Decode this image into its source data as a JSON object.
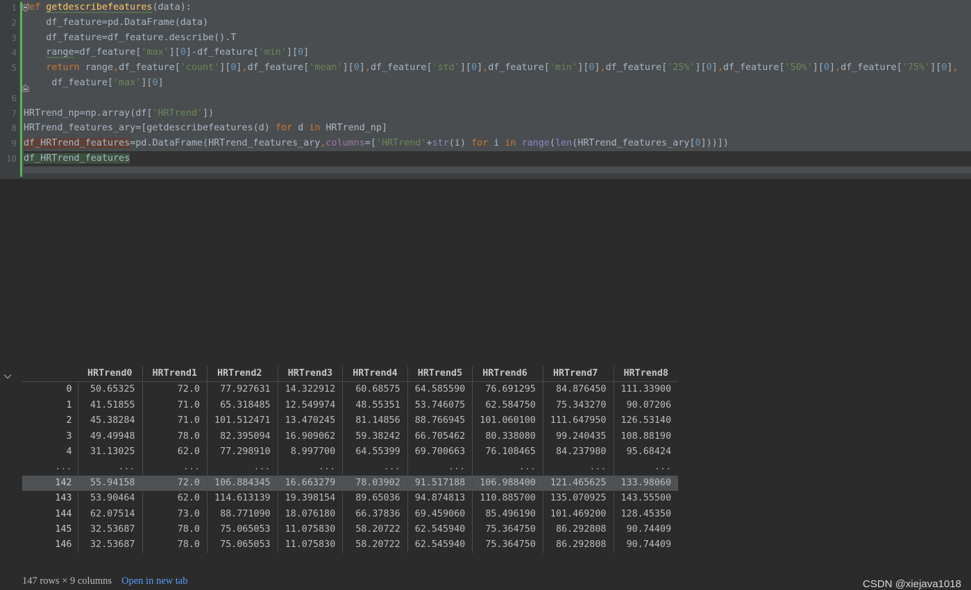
{
  "editor": {
    "line_numbers": [
      "1",
      "2",
      "3",
      "4",
      "5",
      "6",
      "7",
      "8",
      "9",
      "10"
    ],
    "lines": [
      "def getdescribefeatures(data):",
      "    df_feature=pd.DataFrame(data)",
      "    df_feature=df_feature.describe().T",
      "    range=df_feature['max'][0]-df_feature['min'][0]",
      "    return range,df_feature['count'][0],df_feature['mean'][0],df_feature['std'][0],df_feature['min'][0],df_feature['25%'][0],df_feature['50%'][0],df_feature['75%'][0],",
      "     df_feature['max'][0]",
      "",
      "HRTrend_np=np.array(df['HRTrend'])",
      "HRTrend_features_ary=[getdescribefeatures(d) for d in HRTrend_np]",
      "df_HRTrend_features=pd.DataFrame(HRTrend_features_ary,columns=['HRTrend'+str(i) for i in range(len(HRTrend_features_ary[0]))])",
      "df_HRTrend_features"
    ],
    "fold_icons": [
      "fold-collapse-icon",
      "fold-end-icon"
    ],
    "change_marker_color": "#55b555"
  },
  "output": {
    "expand_icon": "chevron-down-icon",
    "columns": [
      "HRTrend0",
      "HRTrend1",
      "HRTrend2",
      "HRTrend3",
      "HRTrend4",
      "HRTrend5",
      "HRTrend6",
      "HRTrend7",
      "HRTrend8"
    ],
    "rows": [
      {
        "index": "0",
        "selected": false,
        "values": [
          "50.65325",
          "72.0",
          "77.927631",
          "14.322912",
          "60.68575",
          "64.585590",
          "76.691295",
          "84.876450",
          "111.33900"
        ]
      },
      {
        "index": "1",
        "selected": false,
        "values": [
          "41.51855",
          "71.0",
          "65.318485",
          "12.549974",
          "48.55351",
          "53.746075",
          "62.584750",
          "75.343270",
          "90.07206"
        ]
      },
      {
        "index": "2",
        "selected": false,
        "values": [
          "45.38284",
          "71.0",
          "101.512471",
          "13.470245",
          "81.14856",
          "88.766945",
          "101.060100",
          "111.647950",
          "126.53140"
        ]
      },
      {
        "index": "3",
        "selected": false,
        "values": [
          "49.49948",
          "78.0",
          "82.395094",
          "16.909062",
          "59.38242",
          "66.705462",
          "80.338080",
          "99.240435",
          "108.88190"
        ]
      },
      {
        "index": "4",
        "selected": false,
        "values": [
          "31.13025",
          "62.0",
          "77.298910",
          "8.997700",
          "64.55399",
          "69.700663",
          "76.108465",
          "84.237980",
          "95.68424"
        ]
      },
      {
        "index": "...",
        "selected": false,
        "ellipsis": true,
        "values": [
          "...",
          "...",
          "...",
          "...",
          "...",
          "...",
          "...",
          "...",
          "..."
        ]
      },
      {
        "index": "142",
        "selected": true,
        "values": [
          "55.94158",
          "72.0",
          "106.884345",
          "16.663279",
          "78.03902",
          "91.517188",
          "106.988400",
          "121.465625",
          "133.98060"
        ]
      },
      {
        "index": "143",
        "selected": false,
        "values": [
          "53.90464",
          "62.0",
          "114.613139",
          "19.398154",
          "89.65036",
          "94.874813",
          "110.885700",
          "135.070925",
          "143.55500"
        ]
      },
      {
        "index": "144",
        "selected": false,
        "values": [
          "62.07514",
          "73.0",
          "88.771090",
          "18.076180",
          "66.37836",
          "69.459060",
          "85.496190",
          "101.469200",
          "128.45350"
        ]
      },
      {
        "index": "145",
        "selected": false,
        "values": [
          "32.53687",
          "78.0",
          "75.065053",
          "11.075830",
          "58.20722",
          "62.545940",
          "75.364750",
          "86.292808",
          "90.74409"
        ]
      },
      {
        "index": "146",
        "selected": false,
        "values": [
          "32.53687",
          "78.0",
          "75.065053",
          "11.075830",
          "58.20722",
          "62.545940",
          "75.364750",
          "86.292808",
          "90.74409"
        ]
      }
    ],
    "footer_text": "147 rows × 9 columns",
    "open_in_new_tab_label": "Open in new tab"
  },
  "watermark": "CSDN @xiejava1018",
  "colors": {
    "editor_bg": "#4a4d4f",
    "gutter_bg": "#3c3f41",
    "output_bg": "#2b2b2b",
    "keyword": "#cc7832",
    "function": "#ffc66d",
    "string": "#6a8759",
    "number": "#6897bb",
    "identifier": "#a9b7c6",
    "link": "#589df6",
    "selected_row": "#4e5254"
  }
}
